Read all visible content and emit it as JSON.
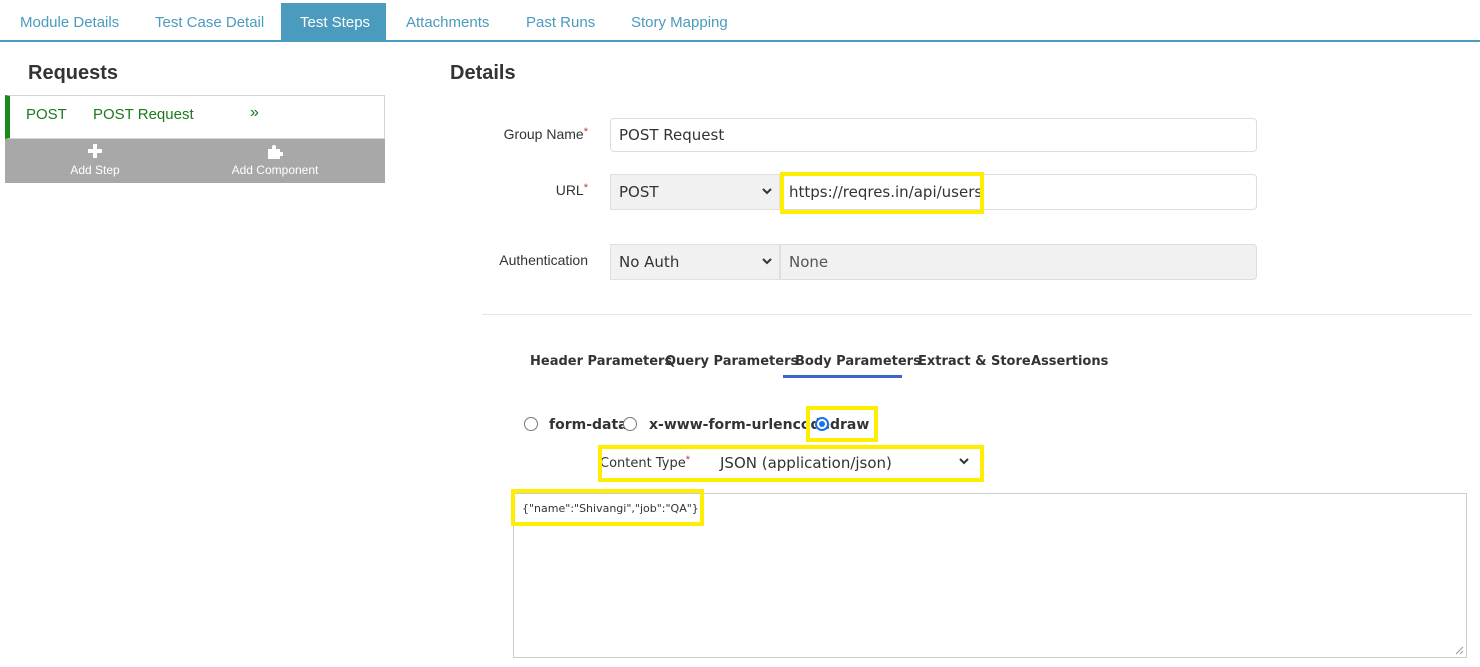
{
  "tabs": [
    {
      "label": "Module Details",
      "active": false
    },
    {
      "label": "Test Case Detail",
      "active": false
    },
    {
      "label": "Test Steps",
      "active": true
    },
    {
      "label": "Attachments",
      "active": false
    },
    {
      "label": "Past Runs",
      "active": false
    },
    {
      "label": "Story Mapping",
      "active": false
    }
  ],
  "requests": {
    "heading": "Requests",
    "items": [
      {
        "method": "POST",
        "name": "POST Request",
        "arrow": "»"
      }
    ],
    "add_step": "Add Step",
    "add_component": "Add Component"
  },
  "details": {
    "heading": "Details",
    "group_name_label": "Group Name",
    "group_name_value": "POST Request",
    "url_label": "URL",
    "method_value": "POST",
    "url_value": "https://reqres.in/api/users",
    "auth_label": "Authentication",
    "auth_value": "No Auth",
    "auth_detail": "None",
    "required_mark": "*"
  },
  "subtabs": [
    {
      "label": "Header Parameters",
      "active": false
    },
    {
      "label": "Query Parameters",
      "active": false
    },
    {
      "label": "Body Parameters",
      "active": true
    },
    {
      "label": "Extract & Store",
      "active": false
    },
    {
      "label": "Assertions",
      "active": false
    }
  ],
  "body": {
    "options": [
      {
        "label": "form-data",
        "checked": false
      },
      {
        "label": "x-www-form-urlencoded",
        "checked": false
      },
      {
        "label": "raw",
        "checked": true
      }
    ],
    "content_type_label": "Content Type",
    "content_type_value": "JSON (application/json)",
    "raw_text": "{\"name\":\"Shivangi\",\"job\":\"QA\"}"
  },
  "colors": {
    "accent": "#4a9bbd",
    "method_green": "#1a7a1a",
    "highlight": "#ffee00",
    "required": "#c0392b"
  }
}
